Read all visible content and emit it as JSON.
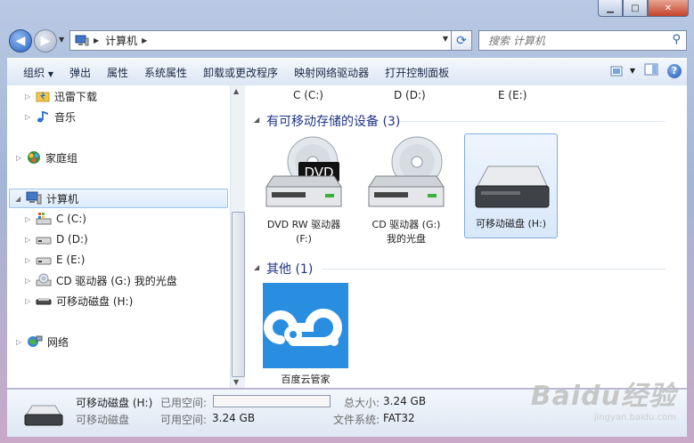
{
  "address": {
    "crumb": "计算机"
  },
  "search": {
    "placeholder": "搜索 计算机"
  },
  "toolbar": {
    "items": [
      "组织",
      "弹出",
      "属性",
      "系统属性",
      "卸载或更改程序",
      "映射网络驱动器",
      "打开控制面板"
    ]
  },
  "nav": {
    "items": [
      {
        "label": "迅雷下载",
        "icon": "xunlei-folder-icon"
      },
      {
        "label": "音乐",
        "icon": "music-icon"
      },
      {
        "label": "家庭组",
        "icon": "homegroup-icon"
      },
      {
        "label": "计算机",
        "icon": "computer-icon"
      },
      {
        "label": "C (C:)",
        "icon": "system-drive-icon"
      },
      {
        "label": "D (D:)",
        "icon": "drive-icon"
      },
      {
        "label": "E (E:)",
        "icon": "drive-icon"
      },
      {
        "label": "CD 驱动器 (G:) 我的光盘",
        "icon": "cd-drive-icon"
      },
      {
        "label": "可移动磁盘 (H:)",
        "icon": "removable-disk-icon"
      },
      {
        "label": "网络",
        "icon": "network-icon"
      }
    ]
  },
  "content": {
    "hard_drives": [
      "C (C:)",
      "D (D:)",
      "E (E:)"
    ],
    "removable_group": "有可移动存储的设备 (3)",
    "removable": [
      {
        "line1": "DVD RW 驱动器",
        "line2": "(F:)",
        "badge": "DVD"
      },
      {
        "line1": "CD 驱动器 (G:)",
        "line2": "我的光盘"
      },
      {
        "line1": "可移动磁盘 (H:)",
        "line2": ""
      }
    ],
    "other_group": "其他 (1)",
    "other": [
      {
        "label": "百度云管家"
      }
    ]
  },
  "details": {
    "name": "可移动磁盘 (H:)",
    "type": "可移动磁盘",
    "used_label": "已用空间:",
    "used_fraction": 0,
    "free_label": "可用空间:",
    "free_value": "3.24 GB",
    "total_label": "总大小:",
    "total_value": "3.24 GB",
    "fs_label": "文件系统:",
    "fs_value": "FAT32"
  },
  "watermark": {
    "text": "Baidu经验",
    "url": "jingyan.baidu.com"
  },
  "colors": {
    "accent": "#1e3287",
    "selection": "#dcebfb",
    "baidu_blue": "#2a8ee0"
  }
}
